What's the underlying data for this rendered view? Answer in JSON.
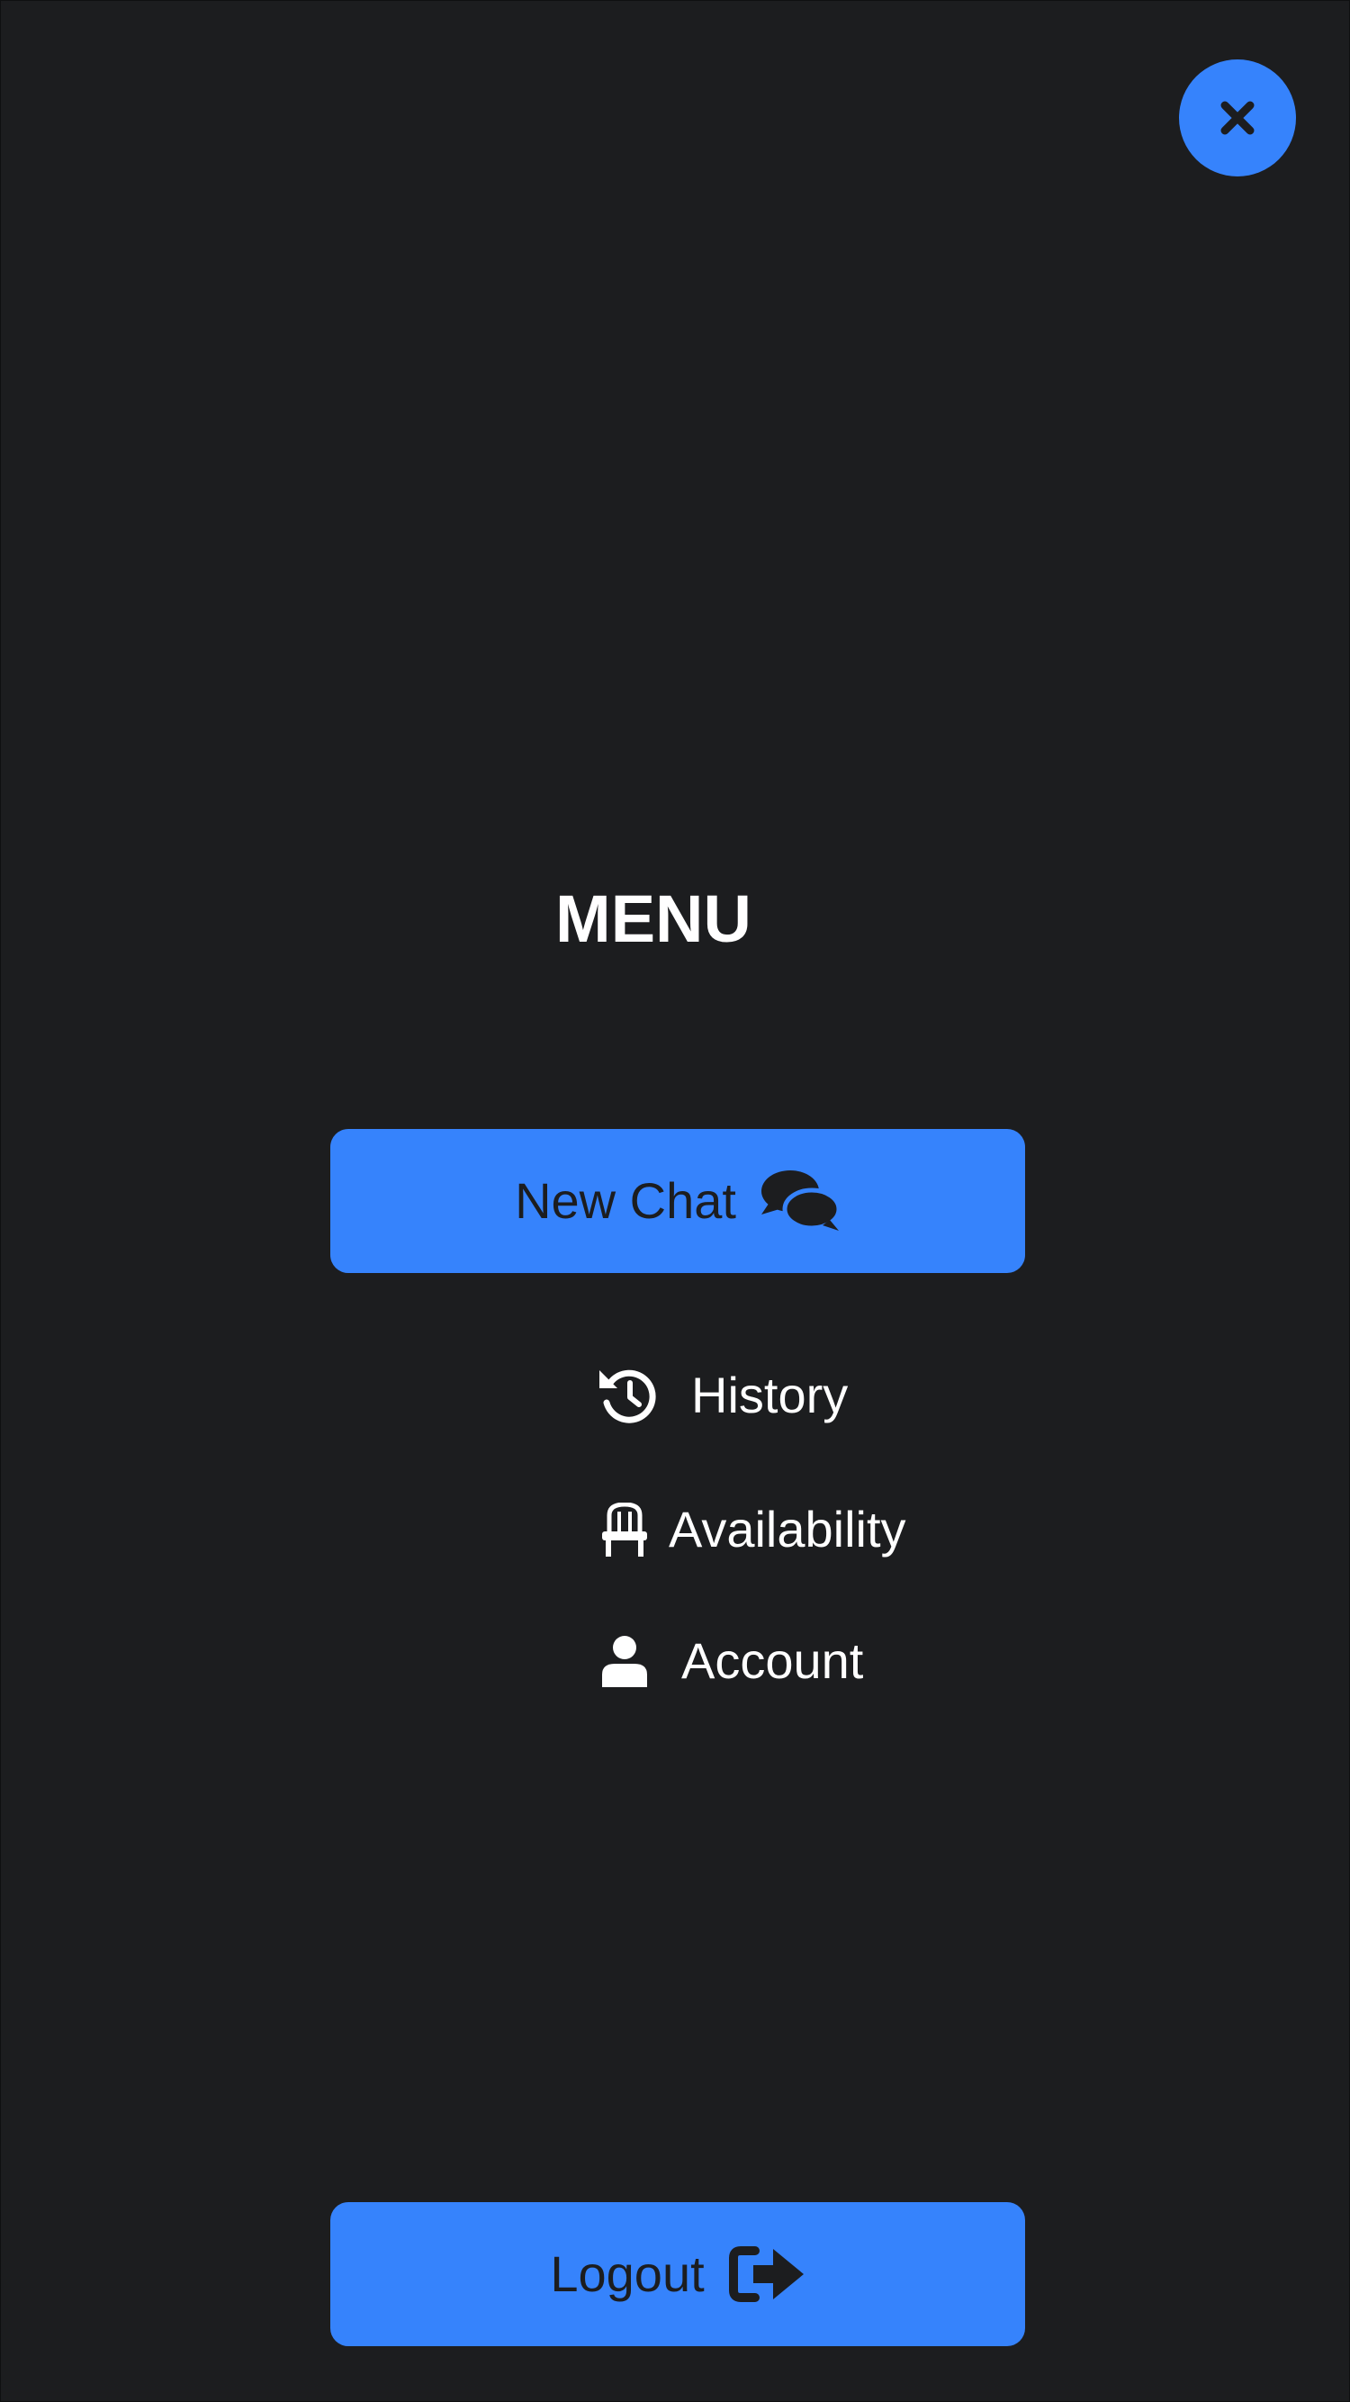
{
  "menu": {
    "title": "MENU",
    "close_icon": "close-icon",
    "new_chat": {
      "label": "New Chat",
      "icon": "comments-icon"
    },
    "items": [
      {
        "label": "History",
        "icon": "history-icon"
      },
      {
        "label": "Availability",
        "icon": "chair-icon"
      },
      {
        "label": "Account",
        "icon": "user-icon"
      }
    ],
    "logout": {
      "label": "Logout",
      "icon": "sign-out-icon"
    }
  },
  "colors": {
    "background": "#1c1d1f",
    "accent": "#3683fc",
    "text_light": "#ffffff",
    "text_dark": "#1c1d1f"
  }
}
